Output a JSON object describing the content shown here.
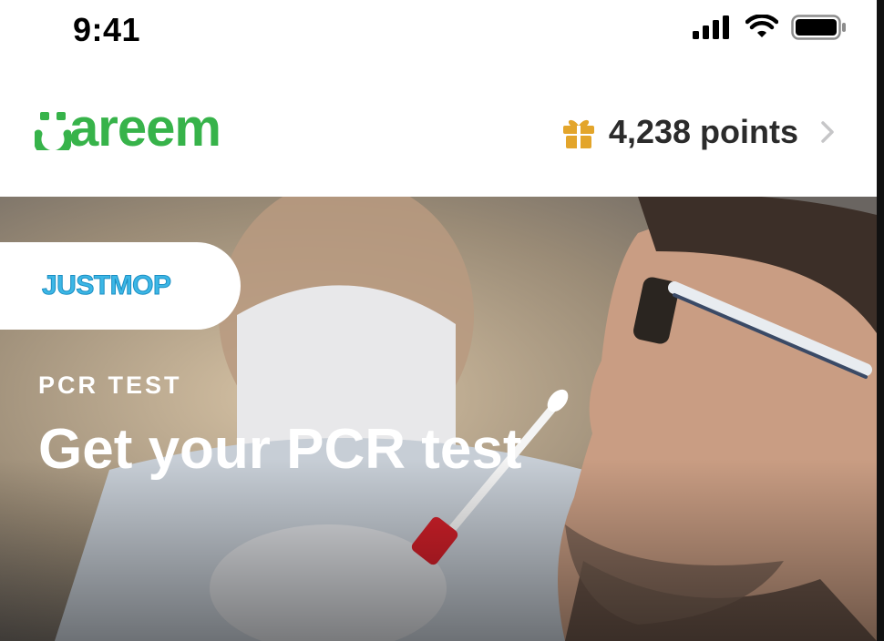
{
  "status_bar": {
    "time": "9:41"
  },
  "header": {
    "logo_text": "careem",
    "points_label": "4,238 points"
  },
  "hero": {
    "brand_name": "JUSTMOP",
    "eyebrow": "PCR TEST",
    "title": "Get your PCR test"
  },
  "colors": {
    "brand_green": "#37b34a",
    "gift_gold": "#e3a52b",
    "justmop_blue": "#3cb7e6"
  }
}
